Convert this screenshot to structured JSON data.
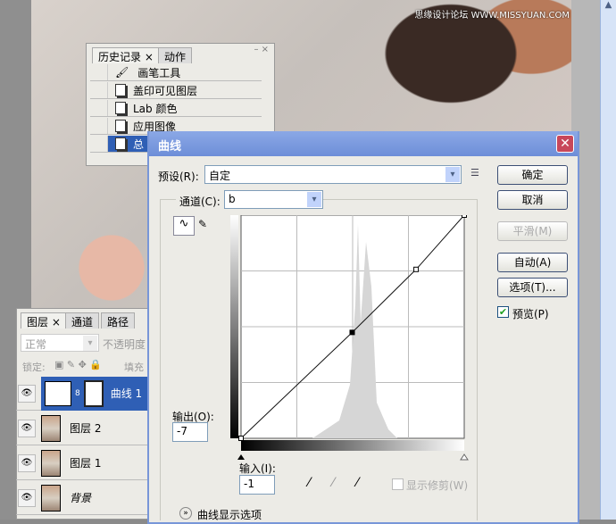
{
  "watermark": "思缘设计论坛 WWW.MISSYUAN.COM",
  "history_panel": {
    "tabs": [
      "历史记录",
      "动作"
    ],
    "items": [
      {
        "label": "画笔工具",
        "icon": "brush-icon"
      },
      {
        "label": "盖印可见图层",
        "icon": "document-icon"
      },
      {
        "label": "Lab 颜色",
        "icon": "document-icon"
      },
      {
        "label": "应用图像",
        "icon": "document-icon"
      },
      {
        "label": "总",
        "icon": "document-icon",
        "selected": true
      }
    ]
  },
  "layers_panel": {
    "tabs": [
      "图层",
      "通道",
      "路径"
    ],
    "blend_mode": "正常",
    "opacity_label": "不透明度",
    "lock_label": "锁定:",
    "fill_label": "填充",
    "layers": [
      {
        "name": "曲线 1",
        "selected": true
      },
      {
        "name": "图层 2"
      },
      {
        "name": "图层 1"
      },
      {
        "name": "背景"
      }
    ]
  },
  "curves_dialog": {
    "title": "曲线",
    "preset_label": "预设(R):",
    "preset_value": "自定",
    "channel_label": "通道(C):",
    "channel_value": "b",
    "buttons": {
      "ok": "确定",
      "cancel": "取消",
      "smooth": "平滑(M)",
      "auto": "自动(A)",
      "options": "选项(T)..."
    },
    "preview_label": "预览(P)",
    "preview_checked": true,
    "output_label": "输出(O):",
    "output_value": "-7",
    "input_label": "输入(I):",
    "input_value": "-1",
    "show_clipping_label": "显示修剪(W)",
    "show_clipping_checked": false,
    "display_options_label": "曲线显示选项",
    "curve_points": [
      [
        -128,
        -128
      ],
      [
        -1,
        -7
      ],
      [
        72,
        65
      ],
      [
        127,
        127
      ]
    ]
  },
  "colors": {
    "titlebar": "#6d8ed8",
    "selection": "#2f5fb5"
  }
}
